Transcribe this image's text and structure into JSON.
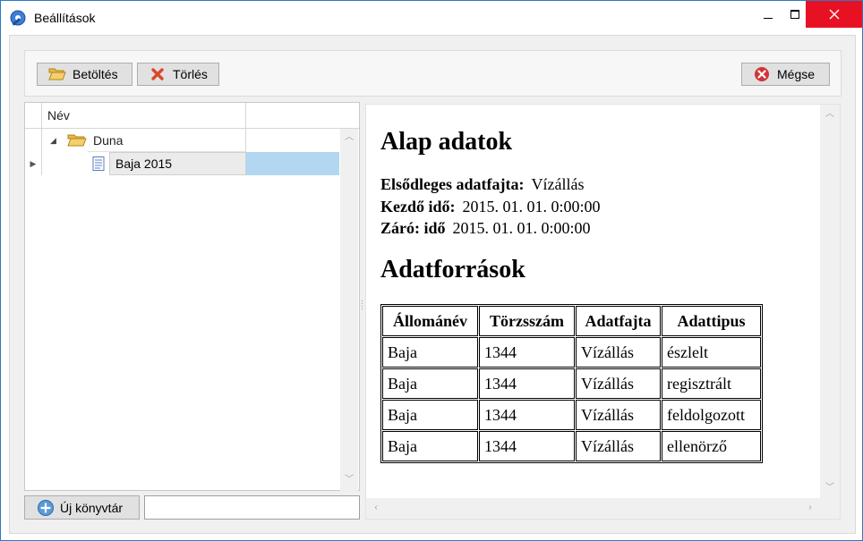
{
  "window": {
    "title": "Beállítások",
    "close_color": "#e81123",
    "icons": {
      "app": "settings-app-icon",
      "minimize": "minimize-icon",
      "maximize": "maximize-icon",
      "close": "close-icon"
    }
  },
  "toolbar": {
    "load_label": "Betöltés",
    "delete_label": "Törlés",
    "cancel_label": "Mégse"
  },
  "tree": {
    "column_header": "Név",
    "items": [
      {
        "label": "Duna",
        "icon": "folder-open-icon",
        "expanded": true
      },
      {
        "label": "Baja 2015",
        "icon": "document-icon",
        "selected": true
      }
    ],
    "selection_color": "#b3d7f0"
  },
  "content": {
    "title": "Alap adatok",
    "fields": [
      {
        "label": "Elsődleges adatfajta:",
        "value": "Vízállás"
      },
      {
        "label": "Kezdő idő:",
        "value": "2015. 01. 01. 0:00:00"
      },
      {
        "label": "Záró: idő",
        "value": "2015. 01. 01. 0:00:00"
      }
    ],
    "sources_title": "Adatforrások",
    "table": {
      "headers": [
        "Állománév",
        "Törzsszám",
        "Adatfajta",
        "Adattipus"
      ],
      "rows": [
        [
          "Baja",
          "1344",
          "Vízállás",
          "észlelt"
        ],
        [
          "Baja",
          "1344",
          "Vízállás",
          "regisztrált"
        ],
        [
          "Baja",
          "1344",
          "Vízállás",
          "feldolgozott"
        ],
        [
          "Baja",
          "1344",
          "Vízállás",
          "ellenörző"
        ]
      ]
    }
  },
  "footer": {
    "new_library_label": "Új könyvtár",
    "name_input_value": ""
  }
}
